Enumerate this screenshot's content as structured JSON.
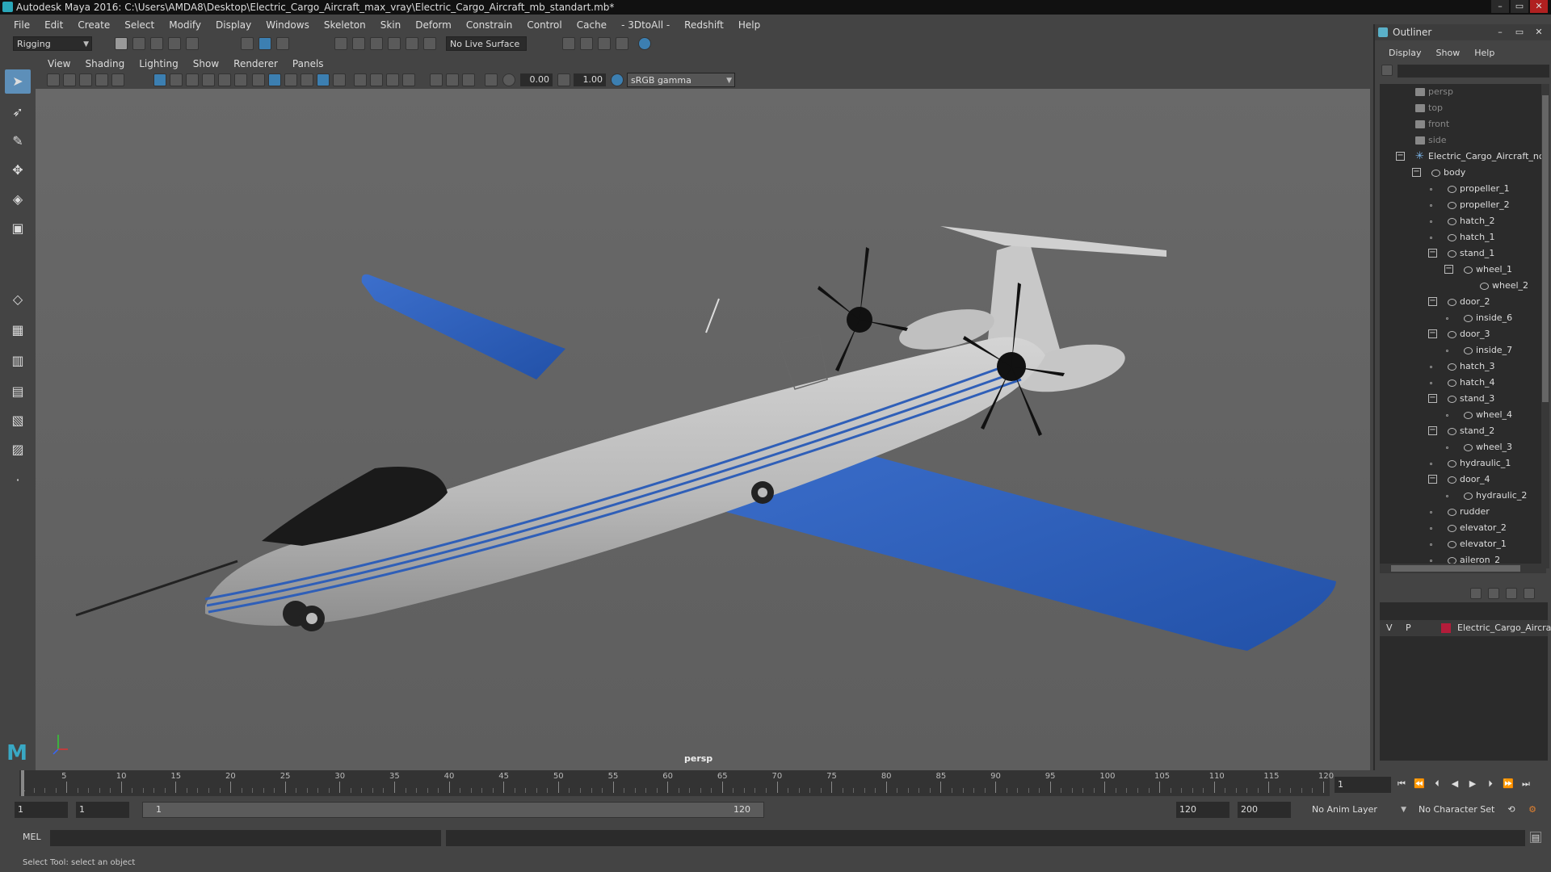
{
  "window": {
    "title": "Autodesk Maya 2016: C:\\Users\\AMDA8\\Desktop\\Electric_Cargo_Aircraft_max_vray\\Electric_Cargo_Aircraft_mb_standart.mb*",
    "minimize": "–",
    "maximize": "▭",
    "close": "✕"
  },
  "menubar": [
    "File",
    "Edit",
    "Create",
    "Select",
    "Modify",
    "Display",
    "Windows",
    "Skeleton",
    "Skin",
    "Deform",
    "Constrain",
    "Control",
    "Cache",
    "- 3DtoAll -",
    "Redshift",
    "Help"
  ],
  "shelf": {
    "mode": "Rigging",
    "live_surface": "No Live Surface"
  },
  "panel": {
    "menus": [
      "View",
      "Shading",
      "Lighting",
      "Show",
      "Renderer",
      "Panels"
    ],
    "exposure": "0.00",
    "gamma": "1.00",
    "color_space": "sRGB gamma",
    "camera_label": "persp"
  },
  "outliner": {
    "title": "Outliner",
    "menus": [
      "Display",
      "Show",
      "Help"
    ],
    "items": [
      {
        "label": "persp",
        "type": "camera"
      },
      {
        "label": "top",
        "type": "camera"
      },
      {
        "label": "front",
        "type": "camera"
      },
      {
        "label": "side",
        "type": "camera"
      },
      {
        "label": "Electric_Cargo_Aircraft_nc",
        "type": "group"
      },
      {
        "label": "body",
        "type": "mesh"
      },
      {
        "label": "propeller_1",
        "type": "mesh"
      },
      {
        "label": "propeller_2",
        "type": "mesh"
      },
      {
        "label": "hatch_2",
        "type": "mesh"
      },
      {
        "label": "hatch_1",
        "type": "mesh"
      },
      {
        "label": "stand_1",
        "type": "mesh"
      },
      {
        "label": "wheel_1",
        "type": "mesh"
      },
      {
        "label": "wheel_2",
        "type": "mesh"
      },
      {
        "label": "door_2",
        "type": "mesh"
      },
      {
        "label": "inside_6",
        "type": "mesh"
      },
      {
        "label": "door_3",
        "type": "mesh"
      },
      {
        "label": "inside_7",
        "type": "mesh"
      },
      {
        "label": "hatch_3",
        "type": "mesh"
      },
      {
        "label": "hatch_4",
        "type": "mesh"
      },
      {
        "label": "stand_3",
        "type": "mesh"
      },
      {
        "label": "wheel_4",
        "type": "mesh"
      },
      {
        "label": "stand_2",
        "type": "mesh"
      },
      {
        "label": "wheel_3",
        "type": "mesh"
      },
      {
        "label": "hydraulic_1",
        "type": "mesh"
      },
      {
        "label": "door_4",
        "type": "mesh"
      },
      {
        "label": "hydraulic_2",
        "type": "mesh"
      },
      {
        "label": "rudder",
        "type": "mesh"
      },
      {
        "label": "elevator_2",
        "type": "mesh"
      },
      {
        "label": "elevator_1",
        "type": "mesh"
      },
      {
        "label": "aileron_2",
        "type": "mesh"
      }
    ]
  },
  "layers": {
    "v": "V",
    "p": "P",
    "name": "Electric_Cargo_Aircraft",
    "color": "#b31c3a"
  },
  "timeline": {
    "ticks": [
      "1",
      "5",
      "10",
      "15",
      "20",
      "25",
      "30",
      "35",
      "40",
      "45",
      "50",
      "55",
      "60",
      "65",
      "70",
      "75",
      "80",
      "85",
      "90",
      "95",
      "100",
      "105",
      "110",
      "115",
      "120"
    ],
    "current_frame": "1"
  },
  "range": {
    "start": "1",
    "anim_start": "1",
    "slider_start": "1",
    "slider_end": "120",
    "anim_end": "120",
    "end": "200",
    "anim_layer": "No Anim Layer",
    "character_set": "No Character Set"
  },
  "cmdline": {
    "label": "MEL"
  },
  "status": {
    "help": "Select Tool: select an object"
  },
  "colors": {
    "accent_blue": "#5d8fb9",
    "wing_blue": "#2f5fb8",
    "fuselage": "#b8b8b8"
  }
}
